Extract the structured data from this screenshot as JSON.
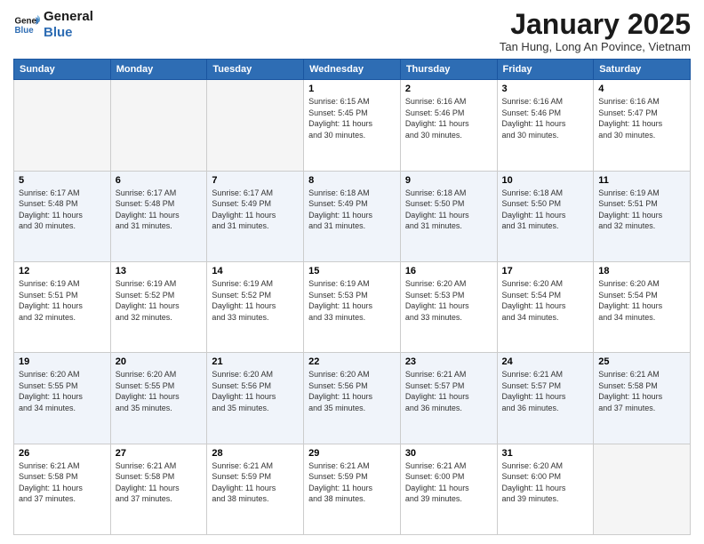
{
  "logo": {
    "line1": "General",
    "line2": "Blue"
  },
  "title": "January 2025",
  "subtitle": "Tan Hung, Long An Povince, Vietnam",
  "weekdays": [
    "Sunday",
    "Monday",
    "Tuesday",
    "Wednesday",
    "Thursday",
    "Friday",
    "Saturday"
  ],
  "weeks": [
    [
      {
        "day": "",
        "info": ""
      },
      {
        "day": "",
        "info": ""
      },
      {
        "day": "",
        "info": ""
      },
      {
        "day": "1",
        "info": "Sunrise: 6:15 AM\nSunset: 5:45 PM\nDaylight: 11 hours\nand 30 minutes."
      },
      {
        "day": "2",
        "info": "Sunrise: 6:16 AM\nSunset: 5:46 PM\nDaylight: 11 hours\nand 30 minutes."
      },
      {
        "day": "3",
        "info": "Sunrise: 6:16 AM\nSunset: 5:46 PM\nDaylight: 11 hours\nand 30 minutes."
      },
      {
        "day": "4",
        "info": "Sunrise: 6:16 AM\nSunset: 5:47 PM\nDaylight: 11 hours\nand 30 minutes."
      }
    ],
    [
      {
        "day": "5",
        "info": "Sunrise: 6:17 AM\nSunset: 5:48 PM\nDaylight: 11 hours\nand 30 minutes."
      },
      {
        "day": "6",
        "info": "Sunrise: 6:17 AM\nSunset: 5:48 PM\nDaylight: 11 hours\nand 31 minutes."
      },
      {
        "day": "7",
        "info": "Sunrise: 6:17 AM\nSunset: 5:49 PM\nDaylight: 11 hours\nand 31 minutes."
      },
      {
        "day": "8",
        "info": "Sunrise: 6:18 AM\nSunset: 5:49 PM\nDaylight: 11 hours\nand 31 minutes."
      },
      {
        "day": "9",
        "info": "Sunrise: 6:18 AM\nSunset: 5:50 PM\nDaylight: 11 hours\nand 31 minutes."
      },
      {
        "day": "10",
        "info": "Sunrise: 6:18 AM\nSunset: 5:50 PM\nDaylight: 11 hours\nand 31 minutes."
      },
      {
        "day": "11",
        "info": "Sunrise: 6:19 AM\nSunset: 5:51 PM\nDaylight: 11 hours\nand 32 minutes."
      }
    ],
    [
      {
        "day": "12",
        "info": "Sunrise: 6:19 AM\nSunset: 5:51 PM\nDaylight: 11 hours\nand 32 minutes."
      },
      {
        "day": "13",
        "info": "Sunrise: 6:19 AM\nSunset: 5:52 PM\nDaylight: 11 hours\nand 32 minutes."
      },
      {
        "day": "14",
        "info": "Sunrise: 6:19 AM\nSunset: 5:52 PM\nDaylight: 11 hours\nand 33 minutes."
      },
      {
        "day": "15",
        "info": "Sunrise: 6:19 AM\nSunset: 5:53 PM\nDaylight: 11 hours\nand 33 minutes."
      },
      {
        "day": "16",
        "info": "Sunrise: 6:20 AM\nSunset: 5:53 PM\nDaylight: 11 hours\nand 33 minutes."
      },
      {
        "day": "17",
        "info": "Sunrise: 6:20 AM\nSunset: 5:54 PM\nDaylight: 11 hours\nand 34 minutes."
      },
      {
        "day": "18",
        "info": "Sunrise: 6:20 AM\nSunset: 5:54 PM\nDaylight: 11 hours\nand 34 minutes."
      }
    ],
    [
      {
        "day": "19",
        "info": "Sunrise: 6:20 AM\nSunset: 5:55 PM\nDaylight: 11 hours\nand 34 minutes."
      },
      {
        "day": "20",
        "info": "Sunrise: 6:20 AM\nSunset: 5:55 PM\nDaylight: 11 hours\nand 35 minutes."
      },
      {
        "day": "21",
        "info": "Sunrise: 6:20 AM\nSunset: 5:56 PM\nDaylight: 11 hours\nand 35 minutes."
      },
      {
        "day": "22",
        "info": "Sunrise: 6:20 AM\nSunset: 5:56 PM\nDaylight: 11 hours\nand 35 minutes."
      },
      {
        "day": "23",
        "info": "Sunrise: 6:21 AM\nSunset: 5:57 PM\nDaylight: 11 hours\nand 36 minutes."
      },
      {
        "day": "24",
        "info": "Sunrise: 6:21 AM\nSunset: 5:57 PM\nDaylight: 11 hours\nand 36 minutes."
      },
      {
        "day": "25",
        "info": "Sunrise: 6:21 AM\nSunset: 5:58 PM\nDaylight: 11 hours\nand 37 minutes."
      }
    ],
    [
      {
        "day": "26",
        "info": "Sunrise: 6:21 AM\nSunset: 5:58 PM\nDaylight: 11 hours\nand 37 minutes."
      },
      {
        "day": "27",
        "info": "Sunrise: 6:21 AM\nSunset: 5:58 PM\nDaylight: 11 hours\nand 37 minutes."
      },
      {
        "day": "28",
        "info": "Sunrise: 6:21 AM\nSunset: 5:59 PM\nDaylight: 11 hours\nand 38 minutes."
      },
      {
        "day": "29",
        "info": "Sunrise: 6:21 AM\nSunset: 5:59 PM\nDaylight: 11 hours\nand 38 minutes."
      },
      {
        "day": "30",
        "info": "Sunrise: 6:21 AM\nSunset: 6:00 PM\nDaylight: 11 hours\nand 39 minutes."
      },
      {
        "day": "31",
        "info": "Sunrise: 6:20 AM\nSunset: 6:00 PM\nDaylight: 11 hours\nand 39 minutes."
      },
      {
        "day": "",
        "info": ""
      }
    ]
  ]
}
